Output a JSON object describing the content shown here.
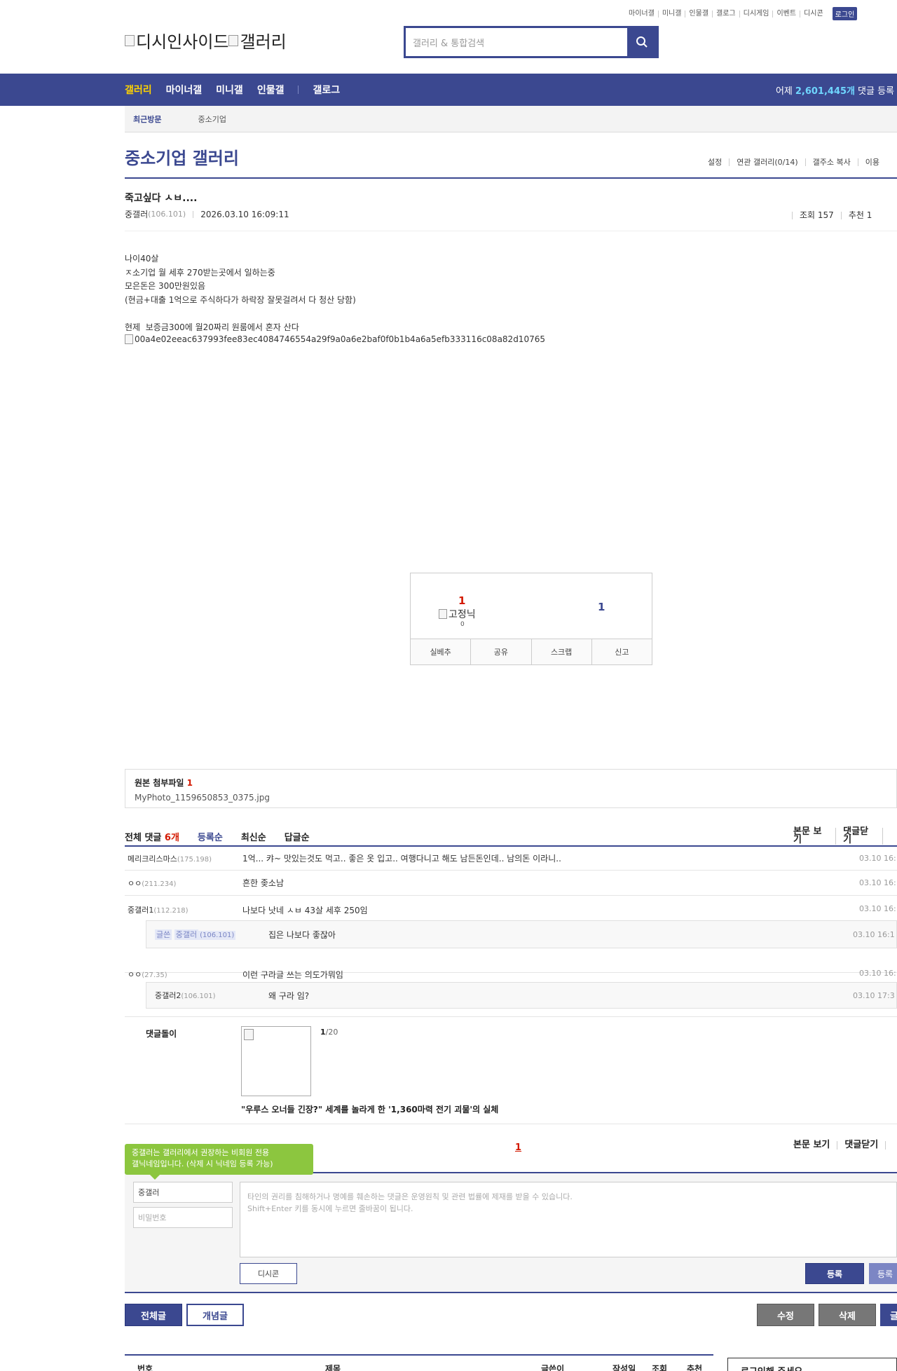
{
  "header": {
    "top_menu": [
      "마이너갤",
      "미니갤",
      "인물갤",
      "갤로그",
      "디시게임",
      "이벤트",
      "디시콘"
    ],
    "login_label": "로그인",
    "logo_text_1": "디시인사이드",
    "logo_text_2": "갤러리",
    "search_placeholder": "갤러리 & 통합검색"
  },
  "nav": {
    "items": [
      "갤러리",
      "마이너갤",
      "미니갤",
      "인물갤"
    ],
    "gallog": "갤로그",
    "stat_prefix": "어제",
    "stat_value": "2,601,445개",
    "stat_suffix": "댓글 등록"
  },
  "recent": {
    "title": "최근방문",
    "item": "중소기업"
  },
  "gallery": {
    "title": "중소기업 갤러리",
    "links": [
      "설정",
      "연관 갤러리(0/14)",
      "갤주소 복사",
      "이용"
    ]
  },
  "post": {
    "title": "죽고싶다 ㅅㅂ....",
    "author": "중갤러",
    "author_ip": "(106.101)",
    "date": "2026.03.10 16:09:11",
    "views": "조회 157",
    "recommend": "추천 1",
    "body_lines": [
      "나이40살",
      "ㅈ소기업 월 세후 270받는곳에서 일하는중",
      "모은돈은 300만원있음",
      "(현금+대출 1억으로 주식하다가 하락장 잘못걸려서 다 청산 당함)",
      "",
      "현제  보증금300에 월20짜리 원룸에서 혼자 산다"
    ],
    "image_alt": "00a4e02eeac637993fee83ec4084746554a29f9a0a6e2baf0f0b1b4a6a5efb333116c08a82d10765"
  },
  "recommend_box": {
    "up_count": "1",
    "fixed_nick_alt": "고정닉",
    "fixed_count": "0",
    "down_count": "1",
    "buttons": [
      "실베추",
      "공유",
      "스크랩",
      "신고"
    ]
  },
  "attachment": {
    "title": "원본 첨부파일",
    "count": "1",
    "file": "MyPhoto_1159650853_0375.jpg"
  },
  "comments": {
    "total_label": "전체 댓글",
    "total_count": "6개",
    "sorts": [
      "등록순",
      "최신순",
      "답글순"
    ],
    "right_links": [
      "본문 보기",
      "댓글닫기"
    ],
    "rows": [
      {
        "nick": "메리크리스마스",
        "ip": "(175.198)",
        "text": "1억... 캬~ 맛있는것도 먹고.. 좋은 옷 입고.. 여행다니고 해도 남든돈인데.. 남의돈 이라니..",
        "date": "03.10 16:"
      },
      {
        "nick": "ㅇㅇ",
        "ip": "(211.234)",
        "text": "흔한 좆소남",
        "date": "03.10 16:"
      },
      {
        "nick": "중갤러1",
        "ip": "(112.218)",
        "text": "나보다 낫네 ㅅㅂ 43살 세후 250임",
        "date": "03.10 16:"
      }
    ],
    "reply1": {
      "tag": "글쓴",
      "nick": "중갤러",
      "ip": "(106.101)",
      "text": "집은 나보다 좋잖아",
      "date": "03.10 16:1"
    },
    "row4": {
      "nick": "ㅇㅇ",
      "ip": "(27.35)",
      "text": "이런 구라글 쓰는 의도가뭐임",
      "date": "03.10 16:"
    },
    "reply2": {
      "nick": "중갤러2",
      "ip": "(106.101)",
      "text": "왜 구라 임?",
      "date": "03.10 17:3"
    },
    "page": "1"
  },
  "dory": {
    "label": "댓글돌이",
    "page_current": "1",
    "page_total": "/20",
    "title": "\"우루스 오너들 긴장?\" 세계를 놀라게 한 '1,360마력 전기 괴물'의 실체"
  },
  "write": {
    "tooltip": "중갤러는 갤러리에서 권장하는 비회원 전용\n갤닉네임입니다. (삭제 시 닉네임 등록 가능)",
    "nick_value": "중갤러",
    "password_placeholder": "비밀번호",
    "textarea_placeholder_1": "타인의 권리를 침해하거나 명예를 훼손하는 댓글은 운영원칙 및 관련 법률에 제재를 받을 수 있습니다.",
    "textarea_placeholder_2": "Shift+Enter 키를 동시에 누르면 줄바꿈이 됩니다.",
    "dccon": "디시콘",
    "register": "등록",
    "register2": "등록"
  },
  "buttons": {
    "all": "전체글",
    "concept": "개념글",
    "edit": "수정",
    "delete": "삭제",
    "write": "글"
  },
  "list": {
    "headers": [
      "번호",
      "제목",
      "글쓴이",
      "작성일",
      "조회",
      "추천"
    ],
    "side_title": "로그인해 주세요"
  }
}
